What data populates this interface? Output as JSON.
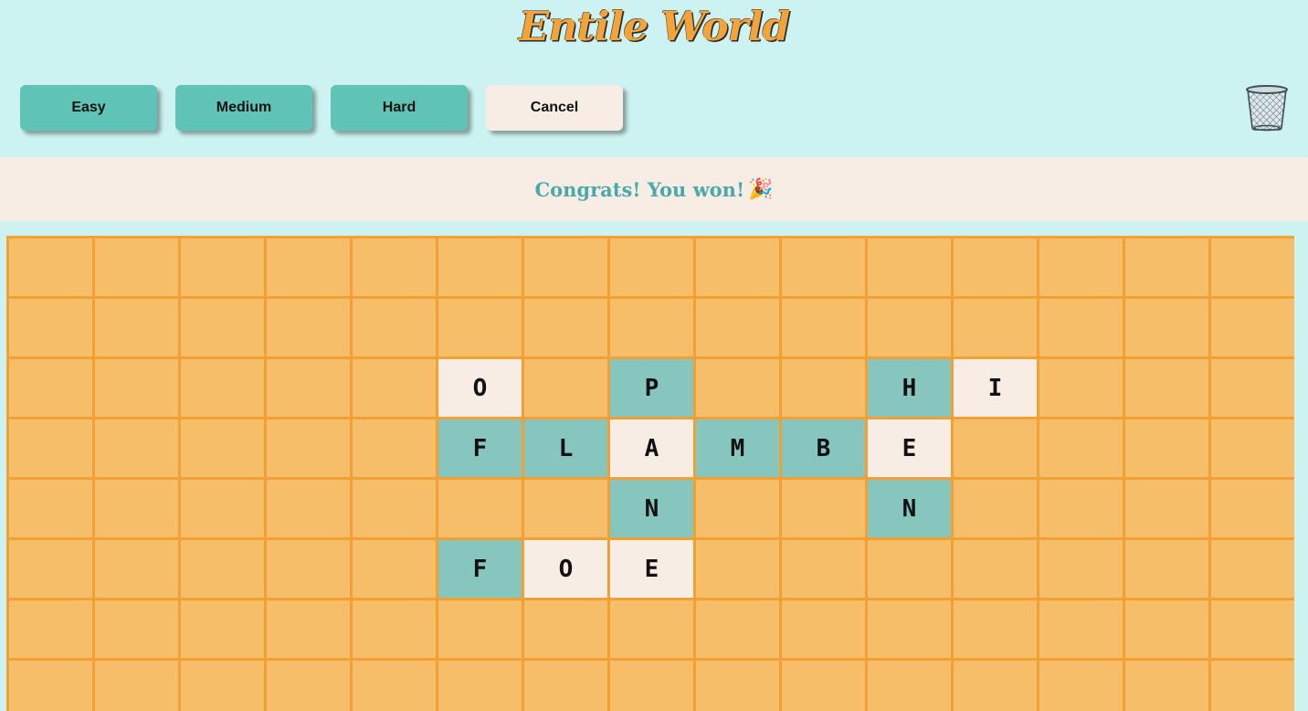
{
  "app": {
    "title": "Entile World"
  },
  "toolbar": {
    "buttons": [
      {
        "label": "Easy",
        "style": "level"
      },
      {
        "label": "Medium",
        "style": "level"
      },
      {
        "label": "Hard",
        "style": "level"
      },
      {
        "label": "Cancel",
        "style": "cancel"
      }
    ],
    "trash_icon": "wastebasket-icon"
  },
  "banner": {
    "message": "Congrats! You won!",
    "icon": "🎉"
  },
  "board": {
    "columns": 15,
    "visible_rows": 8,
    "tiles": [
      {
        "row": 2,
        "col": 5,
        "letter": "O",
        "color": "cream"
      },
      {
        "row": 2,
        "col": 7,
        "letter": "P",
        "color": "teal"
      },
      {
        "row": 2,
        "col": 10,
        "letter": "H",
        "color": "teal"
      },
      {
        "row": 2,
        "col": 11,
        "letter": "I",
        "color": "cream"
      },
      {
        "row": 3,
        "col": 5,
        "letter": "F",
        "color": "teal"
      },
      {
        "row": 3,
        "col": 6,
        "letter": "L",
        "color": "teal"
      },
      {
        "row": 3,
        "col": 7,
        "letter": "A",
        "color": "cream"
      },
      {
        "row": 3,
        "col": 8,
        "letter": "M",
        "color": "teal"
      },
      {
        "row": 3,
        "col": 9,
        "letter": "B",
        "color": "teal"
      },
      {
        "row": 3,
        "col": 10,
        "letter": "E",
        "color": "cream"
      },
      {
        "row": 4,
        "col": 7,
        "letter": "N",
        "color": "teal"
      },
      {
        "row": 4,
        "col": 10,
        "letter": "N",
        "color": "teal"
      },
      {
        "row": 5,
        "col": 5,
        "letter": "F",
        "color": "teal"
      },
      {
        "row": 5,
        "col": 6,
        "letter": "O",
        "color": "cream"
      },
      {
        "row": 5,
        "col": 7,
        "letter": "E",
        "color": "cream"
      }
    ]
  },
  "colors": {
    "background": "#ccf2f1",
    "accent_orange": "#f2a33a",
    "empty_cell": "#f6be68",
    "teal_tile": "#86c6bf",
    "cream_tile": "#f7ede4",
    "level_button": "#5fc4b6",
    "banner_text": "#4aa9ab"
  }
}
